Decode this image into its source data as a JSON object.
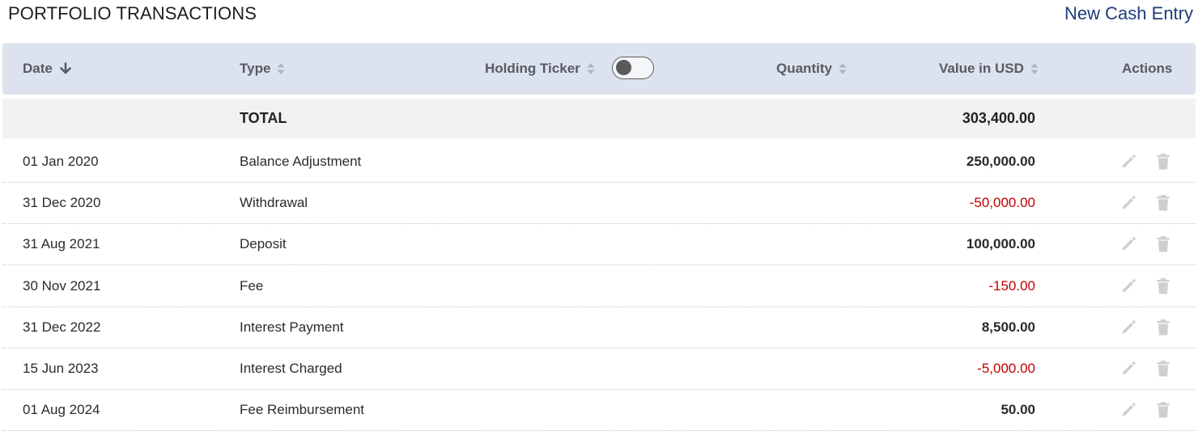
{
  "page": {
    "title": "PORTFOLIO TRANSACTIONS",
    "new_entry_label": "New Cash Entry"
  },
  "columns": {
    "date": "Date",
    "type": "Type",
    "ticker": "Holding Ticker",
    "quantity": "Quantity",
    "value": "Value in USD",
    "actions": "Actions"
  },
  "toggle": {
    "checked": false
  },
  "total": {
    "label": "TOTAL",
    "value": "303,400.00"
  },
  "colors": {
    "negative": "#c00000",
    "accent": "#1d3d7a",
    "header_bg": "#dde3ee"
  },
  "rows": [
    {
      "date": "01 Jan 2020",
      "type": "Balance Adjustment",
      "value": "250,000.00",
      "negative": false
    },
    {
      "date": "31 Dec 2020",
      "type": "Withdrawal",
      "value": "-50,000.00",
      "negative": true
    },
    {
      "date": "31 Aug 2021",
      "type": "Deposit",
      "value": "100,000.00",
      "negative": false
    },
    {
      "date": "30 Nov 2021",
      "type": "Fee",
      "value": "-150.00",
      "negative": true
    },
    {
      "date": "31 Dec 2022",
      "type": "Interest Payment",
      "value": "8,500.00",
      "negative": false
    },
    {
      "date": "15 Jun 2023",
      "type": "Interest Charged",
      "value": "-5,000.00",
      "negative": true
    },
    {
      "date": "01 Aug 2024",
      "type": "Fee Reimbursement",
      "value": "50.00",
      "negative": false
    }
  ],
  "icons": {
    "edit": "pencil-icon",
    "delete": "trash-icon",
    "sort_active": "arrow-down-icon",
    "sort": "sort-icon"
  }
}
